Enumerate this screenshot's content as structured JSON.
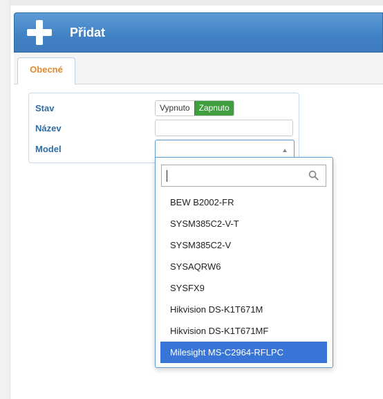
{
  "dialog": {
    "title": "Přidat",
    "tabs": [
      {
        "label": "Obecné"
      }
    ],
    "form": {
      "stav_label": "Stav",
      "toggle_off": "Vypnuto",
      "toggle_on": "Zapnuto",
      "toggle_state": "Zapnuto",
      "nazev_label": "Název",
      "nazev_value": "",
      "model_label": "Model",
      "model_value": ""
    }
  },
  "dropdown": {
    "search_value": "",
    "options": [
      "BEW B2002-FR",
      "SYSM385C2-V-T",
      "SYSM385C2-V",
      "SYSAQRW6",
      "SYSFX9",
      "Hikvision DS-K1T671M",
      "Hikvision DS-K1T671MF",
      "Milesight MS-C2964-RFLPC"
    ],
    "highlighted": "Milesight MS-C2964-RFLPC"
  },
  "colors": {
    "title_bar": "#4283c5",
    "tab_text": "#e08a2e",
    "label": "#2e6da4",
    "toggle_on": "#3f9f3f",
    "highlight": "#3875d7"
  }
}
